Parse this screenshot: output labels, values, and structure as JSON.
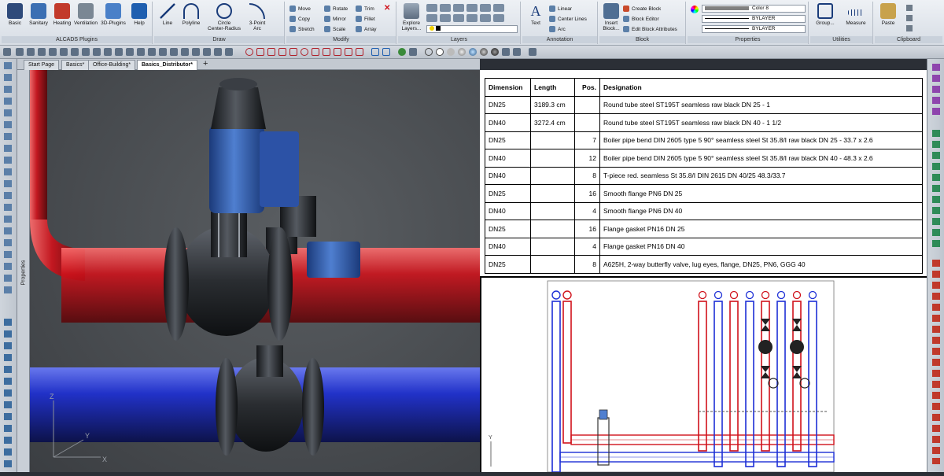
{
  "ribbon": {
    "alcads_buttons": [
      "Basic",
      "Sanitary",
      "Heating",
      "Ventilation",
      "3D-Plugins",
      "Help"
    ],
    "alcads_label": "ALCADS Plugins",
    "draw_buttons": [
      "Line",
      "Polyline",
      "Circle\nCenter-Radius",
      "3-Point\nArc"
    ],
    "draw_label": "Draw",
    "modify_items": [
      "Move",
      "Copy",
      "Stretch",
      "Rotate",
      "Mirror",
      "Scale",
      "Trim",
      "Fillet",
      "Array"
    ],
    "modify_label": "Modify",
    "explore_layers": "Explore\nLayers...",
    "layers_label": "Layers",
    "text_button": "Text",
    "annotation_items": [
      "Linear",
      "Center Lines",
      "Arc"
    ],
    "annotation_label": "Annotation",
    "insert_block": "Insert\nBlock...",
    "block_items": [
      "Create Block",
      "Block Editor",
      "Edit Block Attributes"
    ],
    "block_label": "Block",
    "color_value": "Color 8",
    "linetype_value": "BYLAYER",
    "lineweight_value": "BYLAYER",
    "properties_label": "Properties",
    "group_button": "Group...",
    "measure_button": "Measure",
    "utilities_label": "Utilities",
    "paste_button": "Paste",
    "clipboard_label": "Clipboard"
  },
  "tabs": [
    "Start Page",
    "Basics*",
    "Office-Building*",
    "Basics_Distributor*"
  ],
  "active_tab": 3,
  "side_panel_label": "Properties",
  "axis": {
    "x": "X",
    "y": "Y",
    "z": "Z"
  },
  "bom": {
    "headers": [
      "Dimension",
      "Length",
      "Pos.",
      "Designation"
    ],
    "rows": [
      [
        "DN25",
        "3189.3 cm",
        "",
        "Round tube steel ST195T seamless raw black DN 25 - 1"
      ],
      [
        "DN40",
        "3272.4 cm",
        "",
        "Round tube steel ST195T seamless raw black DN 40 - 1 1/2"
      ],
      [
        "DN25",
        "",
        "7",
        "Boiler pipe bend DIN 2605 type 5 90° seamless steel St 35.8/I raw black DN 25 - 33.7 x 2.6"
      ],
      [
        "DN40",
        "",
        "12",
        "Boiler pipe bend DIN 2605 type 5 90° seamless steel St 35.8/I raw black DN 40 - 48.3 x 2.6"
      ],
      [
        "DN40",
        "",
        "8",
        "T-piece red. seamless St 35.8/I DIN 2615 DN 40/25 48.3/33.7"
      ],
      [
        "DN25",
        "",
        "16",
        "Smooth flange PN6 DN 25"
      ],
      [
        "DN40",
        "",
        "4",
        "Smooth flange PN6 DN 40"
      ],
      [
        "DN25",
        "",
        "16",
        "Flange gasket PN16 DN 25"
      ],
      [
        "DN40",
        "",
        "4",
        "Flange gasket PN16 DN 40"
      ],
      [
        "DN25",
        "",
        "8",
        "A625H, 2-way butterfly valve, lug eyes, flange, DN25, PN6, GGG 40"
      ]
    ]
  },
  "colors": {
    "supply_pipe": "#d0121b",
    "return_pipe": "#1d2fd6",
    "valve_body": "#2a2d31",
    "actuator": "#2f5fb8"
  }
}
